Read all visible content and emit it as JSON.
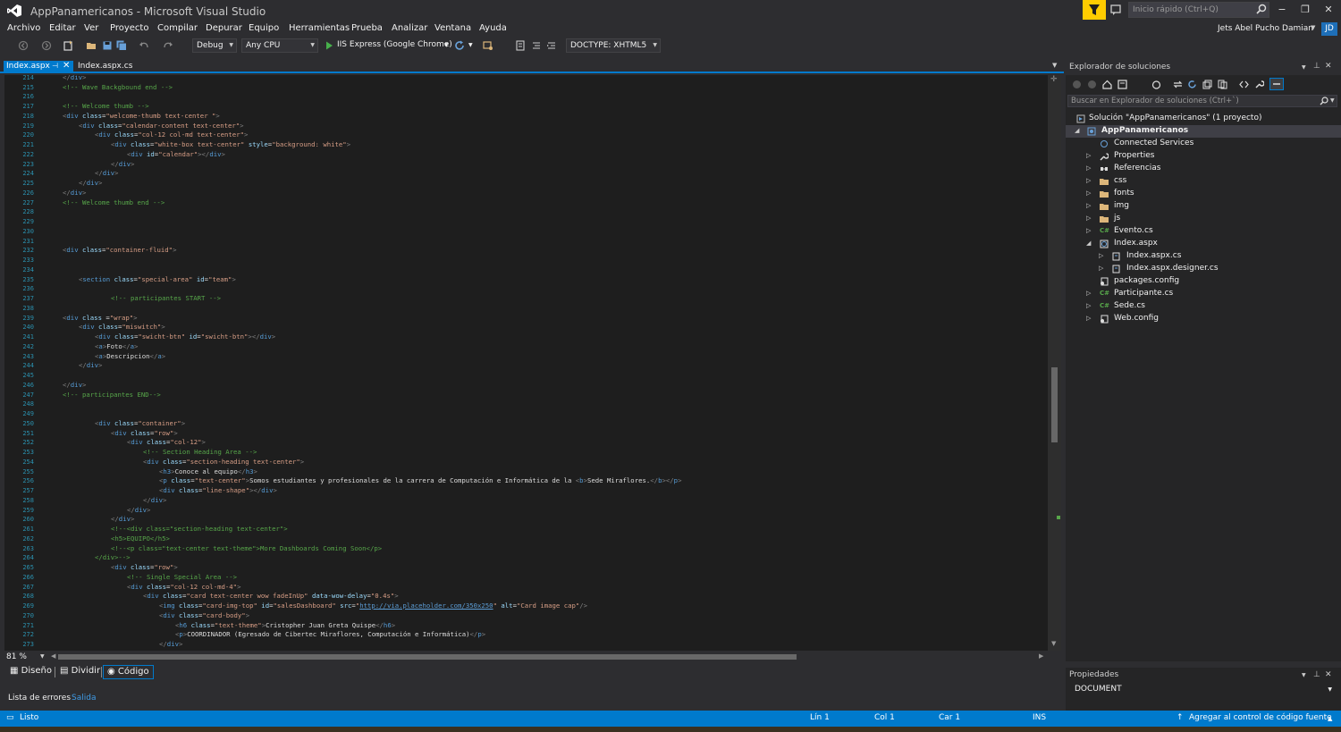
{
  "window": {
    "title": "AppPanamericanos - Microsoft Visual Studio",
    "quick_launch_placeholder": "Inicio rápido (Ctrl+Q)",
    "user_name": "Jets Abel Pucho Damian",
    "user_initials": "JD",
    "min": "−",
    "restore": "❐",
    "close": "✕"
  },
  "menu": [
    "Archivo",
    "Editar",
    "Ver",
    "Proyecto",
    "Compilar",
    "Depurar",
    "Equipo",
    "Herramientas",
    "Prueba",
    "Analizar",
    "Ventana",
    "Ayuda"
  ],
  "toolbar": {
    "config": "Debug",
    "platform": "Any CPU",
    "run_target": "IIS Express (Google Chrome)",
    "doctype": "DOCTYPE: XHTML5"
  },
  "tabs": {
    "active": "Index.aspx",
    "active_pin": "⊣",
    "active_close": "✕",
    "second": "Index.aspx.cs"
  },
  "editor": {
    "line_numbers": [
      "214",
      "215",
      "216",
      "217",
      "218",
      "219",
      "220",
      "221",
      "222",
      "223",
      "224",
      "225",
      "226",
      "227",
      "228",
      "229",
      "230",
      "231",
      "232",
      "233",
      "234",
      "235",
      "236",
      "237",
      "238",
      "239",
      "240",
      "241",
      "242",
      "243",
      "244",
      "245",
      "246",
      "247",
      "248",
      "249",
      "250",
      "251",
      "252",
      "253",
      "254",
      "255",
      "256",
      "257",
      "258",
      "259",
      "260",
      "261",
      "262",
      "263",
      "264",
      "265",
      "266",
      "267",
      "268",
      "269",
      "270",
      "271",
      "272",
      "273"
    ],
    "zoom": "81 %"
  },
  "view_tabs": {
    "design": "Diseño",
    "split": "Dividir",
    "code": "Código"
  },
  "output_tabs": {
    "errors": "Lista de errores",
    "output": "Salida"
  },
  "status": {
    "ready": "Listo",
    "line": "Lín 1",
    "col": "Col 1",
    "car": "Car 1",
    "ins": "INS",
    "source_control": "Agregar al control de código fuente"
  },
  "solution_explorer": {
    "title": "Explorador de soluciones",
    "search_placeholder": "Buscar en Explorador de soluciones (Ctrl+`)",
    "items": [
      {
        "label": "Solución \"AppPanamericanos\" (1 proyecto)",
        "icon": "solution-icon"
      },
      {
        "label": "AppPanamericanos",
        "icon": "project-icon"
      },
      {
        "label": "Connected Services",
        "icon": "connected-services-icon"
      },
      {
        "label": "Properties",
        "icon": "wrench-icon"
      },
      {
        "label": "Referencias",
        "icon": "references-icon"
      },
      {
        "label": "css",
        "icon": "folder-icon"
      },
      {
        "label": "fonts",
        "icon": "folder-icon"
      },
      {
        "label": "img",
        "icon": "folder-icon"
      },
      {
        "label": "js",
        "icon": "folder-icon"
      },
      {
        "label": "Evento.cs",
        "icon": "csharp-file-icon"
      },
      {
        "label": "Index.aspx",
        "icon": "aspx-file-icon"
      },
      {
        "label": "Index.aspx.cs",
        "icon": "cs-file-icon"
      },
      {
        "label": "Index.aspx.designer.cs",
        "icon": "cs-file-icon"
      },
      {
        "label": "packages.config",
        "icon": "config-file-icon"
      },
      {
        "label": "Participante.cs",
        "icon": "csharp-file-icon"
      },
      {
        "label": "Sede.cs",
        "icon": "csharp-file-icon"
      },
      {
        "label": "Web.config",
        "icon": "config-file-icon"
      }
    ]
  },
  "properties": {
    "title": "Propiedades",
    "selected": "DOCUMENT"
  },
  "colors": {
    "accent": "#007acc",
    "background": "#2d2d30",
    "editor_bg": "#1e1e1e"
  }
}
